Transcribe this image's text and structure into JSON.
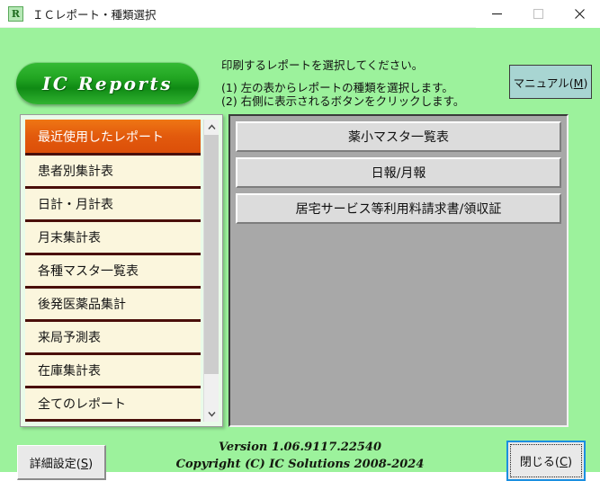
{
  "window": {
    "title": "ＩＣレポート・種類選択",
    "icon": "app-r-icon",
    "minimize": "—",
    "maximize": "□",
    "close": "✕"
  },
  "logo": {
    "text": "IC Reports",
    "color": "#1ba31b"
  },
  "instructions": {
    "main": "印刷するレポートを選択してください。",
    "step1": "(1) 左の表からレポートの種類を選択します。",
    "step2": "(2) 右側に表示されるボタンをクリックします。"
  },
  "manual_button": {
    "label": "マニュアル(M)",
    "accel": "M",
    "color": "#a8d5d2"
  },
  "report_list": {
    "selected_index": 0,
    "selected_color": "#e2590d",
    "item_color": "#fbf6dd",
    "items": [
      {
        "label": "最近使用したレポート"
      },
      {
        "label": "患者別集計表"
      },
      {
        "label": "日計・月計表"
      },
      {
        "label": "月末集計表"
      },
      {
        "label": "各種マスタ一覧表"
      },
      {
        "label": "後発医薬品集計"
      },
      {
        "label": "来局予測表"
      },
      {
        "label": "在庫集計表"
      },
      {
        "label": "全てのレポート"
      }
    ]
  },
  "action_panel": {
    "buttons": [
      {
        "label": "薬小マスタ一覧表"
      },
      {
        "label": "日報/月報"
      },
      {
        "label": "居宅サービス等利用料請求書/領収証"
      }
    ]
  },
  "footer": {
    "version": "Version 1.06.9117.22540",
    "copyright": "Copyright (C) IC Solutions 2008-2024"
  },
  "detail_button": {
    "label": "詳細設定(S)",
    "accel": "S"
  },
  "close_button": {
    "label": "閉じる(C)",
    "accel": "C",
    "focus_color": "#1b8fe0"
  }
}
